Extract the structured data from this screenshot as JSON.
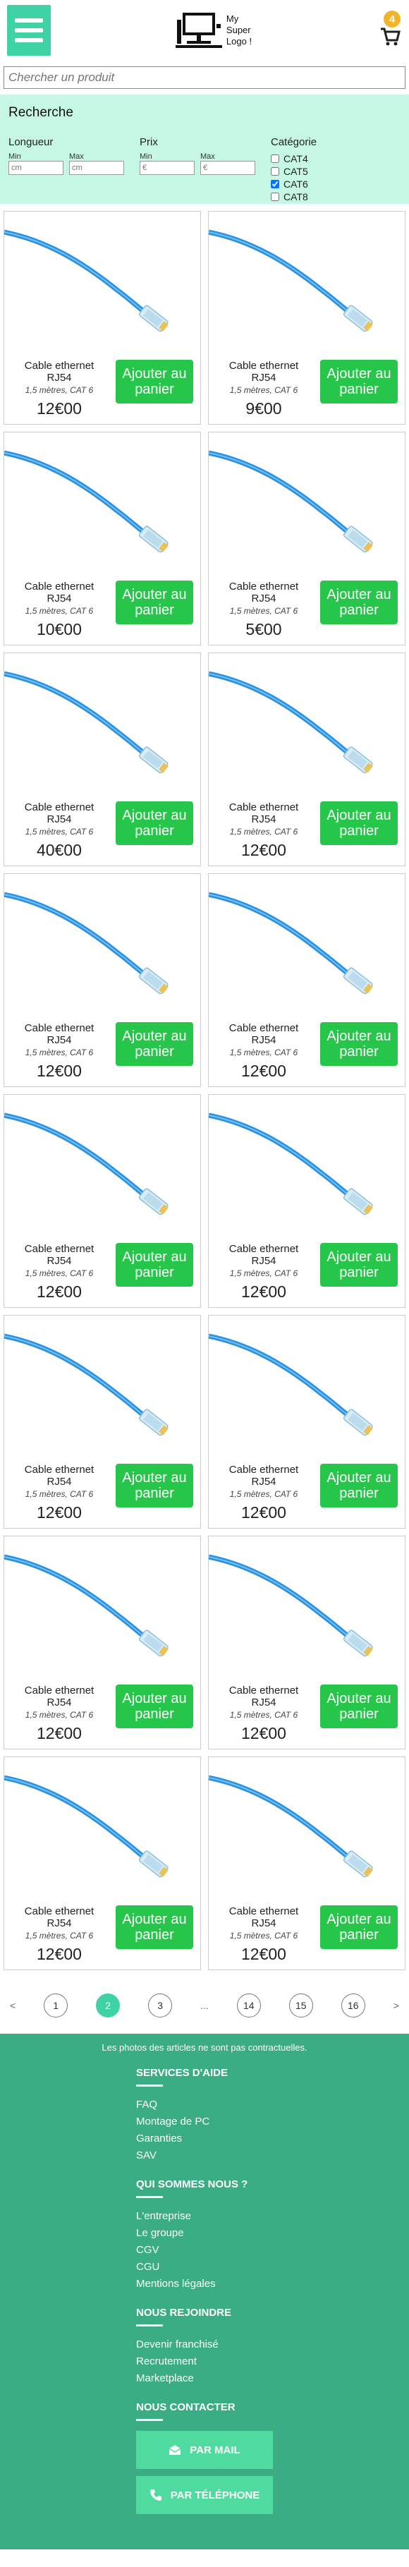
{
  "header": {
    "logo_lines": [
      "My",
      "Super",
      "Logo !"
    ],
    "cart_count": "4"
  },
  "search": {
    "placeholder": "Chercher un produit"
  },
  "filters": {
    "title": "Recherche",
    "length": {
      "label": "Longueur",
      "min_label": "Min",
      "max_label": "Max",
      "min_placeholder": "cm",
      "max_placeholder": "cm"
    },
    "price": {
      "label": "Prix",
      "min_label": "Min",
      "max_label": "Max",
      "min_placeholder": "€",
      "max_placeholder": "€"
    },
    "category": {
      "label": "Catégorie",
      "options": [
        {
          "label": "CAT4",
          "checked": false
        },
        {
          "label": "CAT5",
          "checked": false
        },
        {
          "label": "CAT6",
          "checked": true
        },
        {
          "label": "CAT8",
          "checked": false
        }
      ]
    }
  },
  "products": [
    {
      "name": "Cable ethernet RJ54",
      "desc": "1,5 mètres, CAT 6",
      "price": "12€00",
      "button": "Ajouter au panier"
    },
    {
      "name": "Cable ethernet RJ54",
      "desc": "1,5 mètres, CAT 6",
      "price": "9€00",
      "button": "Ajouter au panier"
    },
    {
      "name": "Cable ethernet RJ54",
      "desc": "1,5 mètres, CAT 6",
      "price": "10€00",
      "button": "Ajouter au panier"
    },
    {
      "name": "Cable ethernet RJ54",
      "desc": "1,5 mètres, CAT 6",
      "price": "5€00",
      "button": "Ajouter au panier"
    },
    {
      "name": "Cable ethernet RJ54",
      "desc": "1,5 mètres, CAT 6",
      "price": "40€00",
      "button": "Ajouter au panier"
    },
    {
      "name": "Cable ethernet RJ54",
      "desc": "1,5 mètres, CAT 6",
      "price": "12€00",
      "button": "Ajouter au panier"
    },
    {
      "name": "Cable ethernet RJ54",
      "desc": "1,5 mètres, CAT 6",
      "price": "12€00",
      "button": "Ajouter au panier"
    },
    {
      "name": "Cable ethernet RJ54",
      "desc": "1,5 mètres, CAT 6",
      "price": "12€00",
      "button": "Ajouter au panier"
    },
    {
      "name": "Cable ethernet RJ54",
      "desc": "1,5 mètres, CAT 6",
      "price": "12€00",
      "button": "Ajouter au panier"
    },
    {
      "name": "Cable ethernet RJ54",
      "desc": "1,5 mètres, CAT 6",
      "price": "12€00",
      "button": "Ajouter au panier"
    },
    {
      "name": "Cable ethernet RJ54",
      "desc": "1,5 mètres, CAT 6",
      "price": "12€00",
      "button": "Ajouter au panier"
    },
    {
      "name": "Cable ethernet RJ54",
      "desc": "1,5 mètres, CAT 6",
      "price": "12€00",
      "button": "Ajouter au panier"
    },
    {
      "name": "Cable ethernet RJ54",
      "desc": "1,5 mètres, CAT 6",
      "price": "12€00",
      "button": "Ajouter au panier"
    },
    {
      "name": "Cable ethernet RJ54",
      "desc": "1,5 mètres, CAT 6",
      "price": "12€00",
      "button": "Ajouter au panier"
    },
    {
      "name": "Cable ethernet RJ54",
      "desc": "1,5 mètres, CAT 6",
      "price": "12€00",
      "button": "Ajouter au panier"
    },
    {
      "name": "Cable ethernet RJ54",
      "desc": "1,5 mètres, CAT 6",
      "price": "12€00",
      "button": "Ajouter au panier"
    }
  ],
  "pagination": {
    "prev": "<",
    "next": ">",
    "pages": [
      "1",
      "2",
      "3",
      "...",
      "14",
      "15",
      "16"
    ],
    "active": "2"
  },
  "footer": {
    "disclaimer": "Les photos des articles ne sont pas contractuelles.",
    "sections": [
      {
        "title": "SERVICES D'AIDE",
        "links": [
          "FAQ",
          "Montage de PC",
          "Garanties",
          "SAV"
        ]
      },
      {
        "title": "QUI SOMMES NOUS ?",
        "links": [
          "L'entreprise",
          "Le groupe",
          "CGV",
          "CGU",
          "Mentions légales"
        ]
      },
      {
        "title": "NOUS REJOINDRE",
        "links": [
          "Devenir franchisé",
          "Recrutement",
          "Marketplace"
        ]
      }
    ],
    "contact": {
      "title": "NOUS CONTACTER",
      "mail_label": "PAR MAIL",
      "phone_label": "PAR TÉLÉPHONE"
    }
  },
  "colors": {
    "accent": "#3fd2a4",
    "button": "#26c64a",
    "footer": "#3aad84",
    "filter_bg": "#c6f7e4",
    "badge": "#f2b52a"
  }
}
